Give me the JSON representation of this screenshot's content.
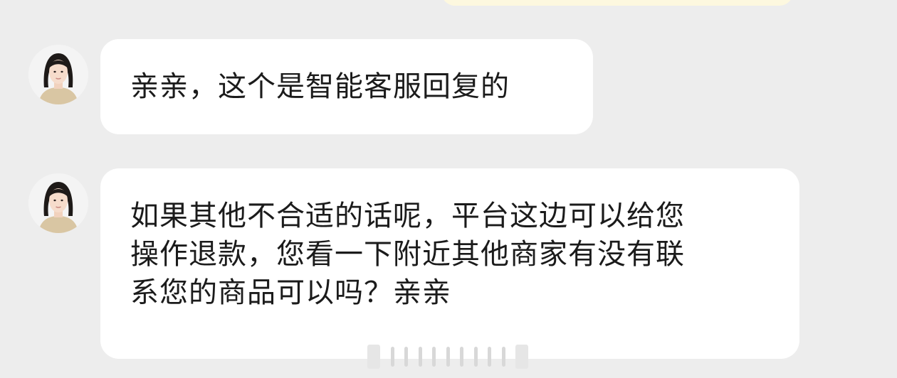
{
  "chat": {
    "messages": [
      {
        "sender": "agent",
        "text": "亲亲，这个是智能客服回复的"
      },
      {
        "sender": "agent",
        "lines": [
          "如果其他不合适的话呢，平台这边可以给您",
          "操作退款，您看一下附近其他商家有没有联",
          "系您的商品可以吗？亲亲"
        ]
      }
    ]
  },
  "colors": {
    "background": "#ededed",
    "bubble": "#ffffff",
    "own_bubble": "#fdf8df",
    "text": "#1b1b1b"
  },
  "icons": {
    "avatar": "agent-avatar-icon"
  }
}
